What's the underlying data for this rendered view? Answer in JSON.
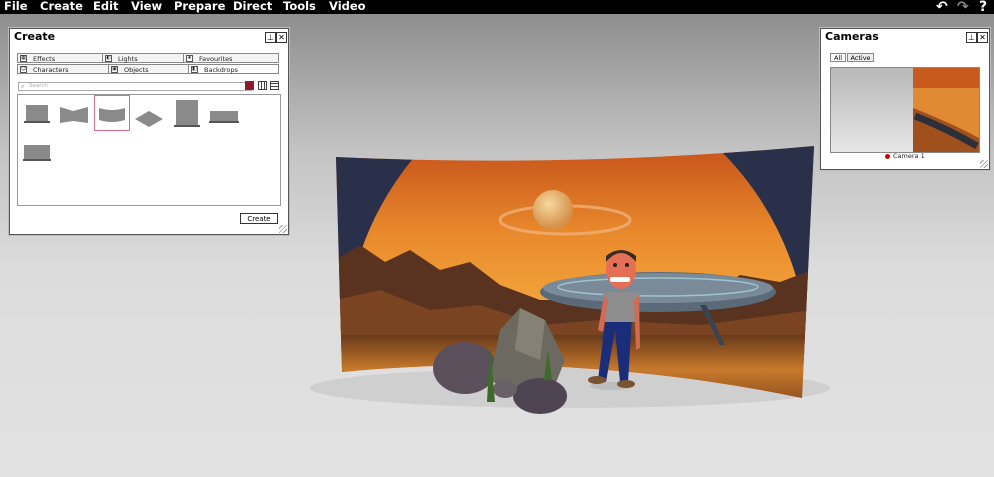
{
  "menu": {
    "items": [
      "File",
      "Create",
      "Edit",
      "View",
      "Prepare",
      "Direct",
      "Tools",
      "Video"
    ],
    "icons": [
      "undo-icon",
      "redo-icon",
      "help-icon"
    ],
    "help_glyph": "?"
  },
  "create_panel": {
    "title": "Create",
    "tabs": [
      {
        "label": "Effects",
        "icon": "effects-icon"
      },
      {
        "label": "Lights",
        "icon": "lights-icon"
      },
      {
        "label": "Favourites",
        "icon": "star-icon"
      },
      {
        "label": "Characters",
        "icon": "characters-icon"
      },
      {
        "label": "Objects",
        "icon": "objects-icon"
      },
      {
        "label": "Backdrops",
        "icon": "backdrops-icon"
      }
    ],
    "active_tab": "Backdrops",
    "search_placeholder": "Search",
    "view_modes": [
      "large-icons-view",
      "grid-view",
      "list-view"
    ],
    "thumbnails": [
      "flat-backdrop",
      "angled-backdrop",
      "curved-backdrop",
      "floor-backdrop",
      "tall-backdrop",
      "wide-backdrop",
      "small-backdrop"
    ],
    "selected_thumbnail": "curved-backdrop",
    "create_button": "Create"
  },
  "cameras_panel": {
    "title": "Cameras",
    "tabs": [
      "All",
      "Active"
    ],
    "active_tab": "All",
    "camera_label": "Camera 1"
  },
  "colors": {
    "menubar": "#000000",
    "selection": "#e06a8a",
    "camera_dot": "#cc0000",
    "view_active": "#8b1a2a"
  }
}
